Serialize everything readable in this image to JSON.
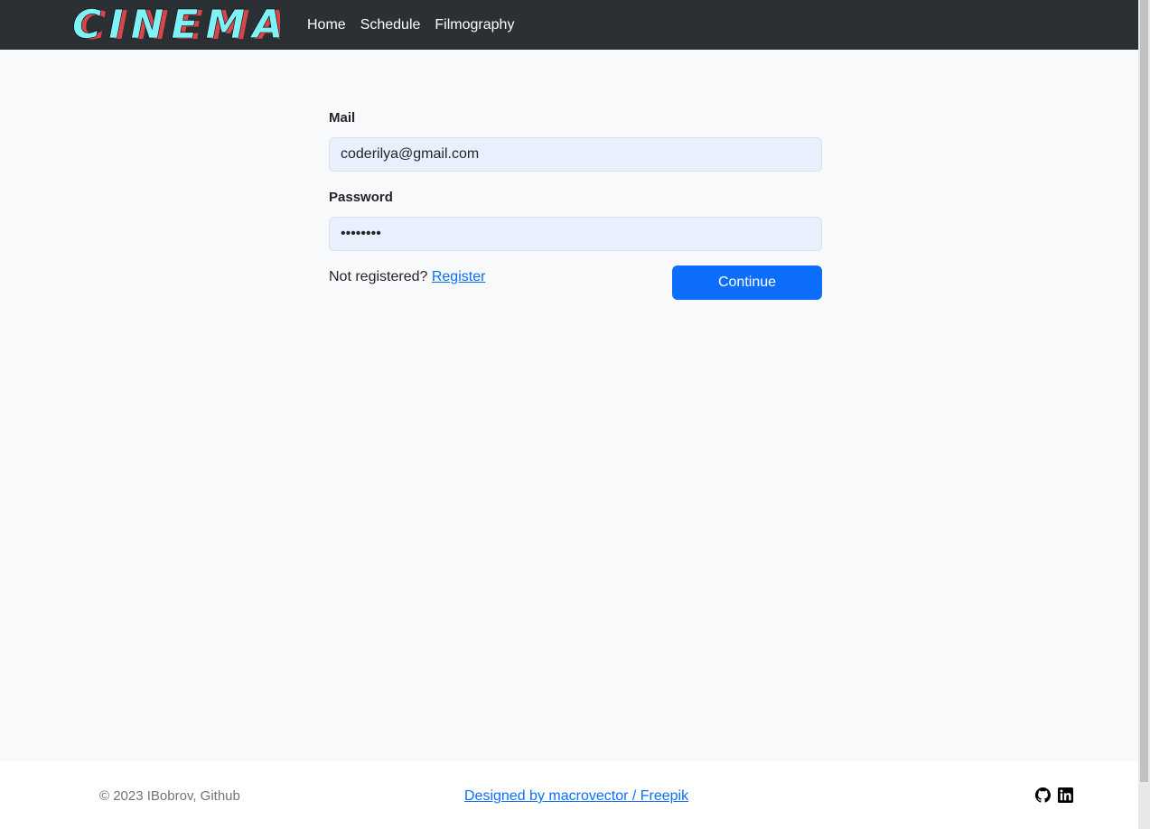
{
  "brand": {
    "logo_text": "CINEMA"
  },
  "nav": {
    "items": [
      {
        "label": "Home"
      },
      {
        "label": "Schedule"
      },
      {
        "label": "Filmography"
      }
    ]
  },
  "form": {
    "mail_label": "Mail",
    "mail_value": "coderilya@gmail.com",
    "password_label": "Password",
    "password_value": "••••••••",
    "not_registered_text": "Not registered?",
    "register_link": "Register",
    "continue_label": "Continue"
  },
  "footer": {
    "copyright": "© 2023 IBobrov, Github",
    "designed_by": "Designed by macrovector / Freepik",
    "social_icons": [
      "github-icon",
      "linkedin-icon"
    ]
  },
  "colors": {
    "navbar_bg": "#2b3035",
    "primary": "#0d6efd",
    "page_bg": "#f8f9fa",
    "input_bg": "#e8f0fe",
    "logo_fill": "#7ef2f6",
    "logo_shadow": "#d9454a"
  }
}
